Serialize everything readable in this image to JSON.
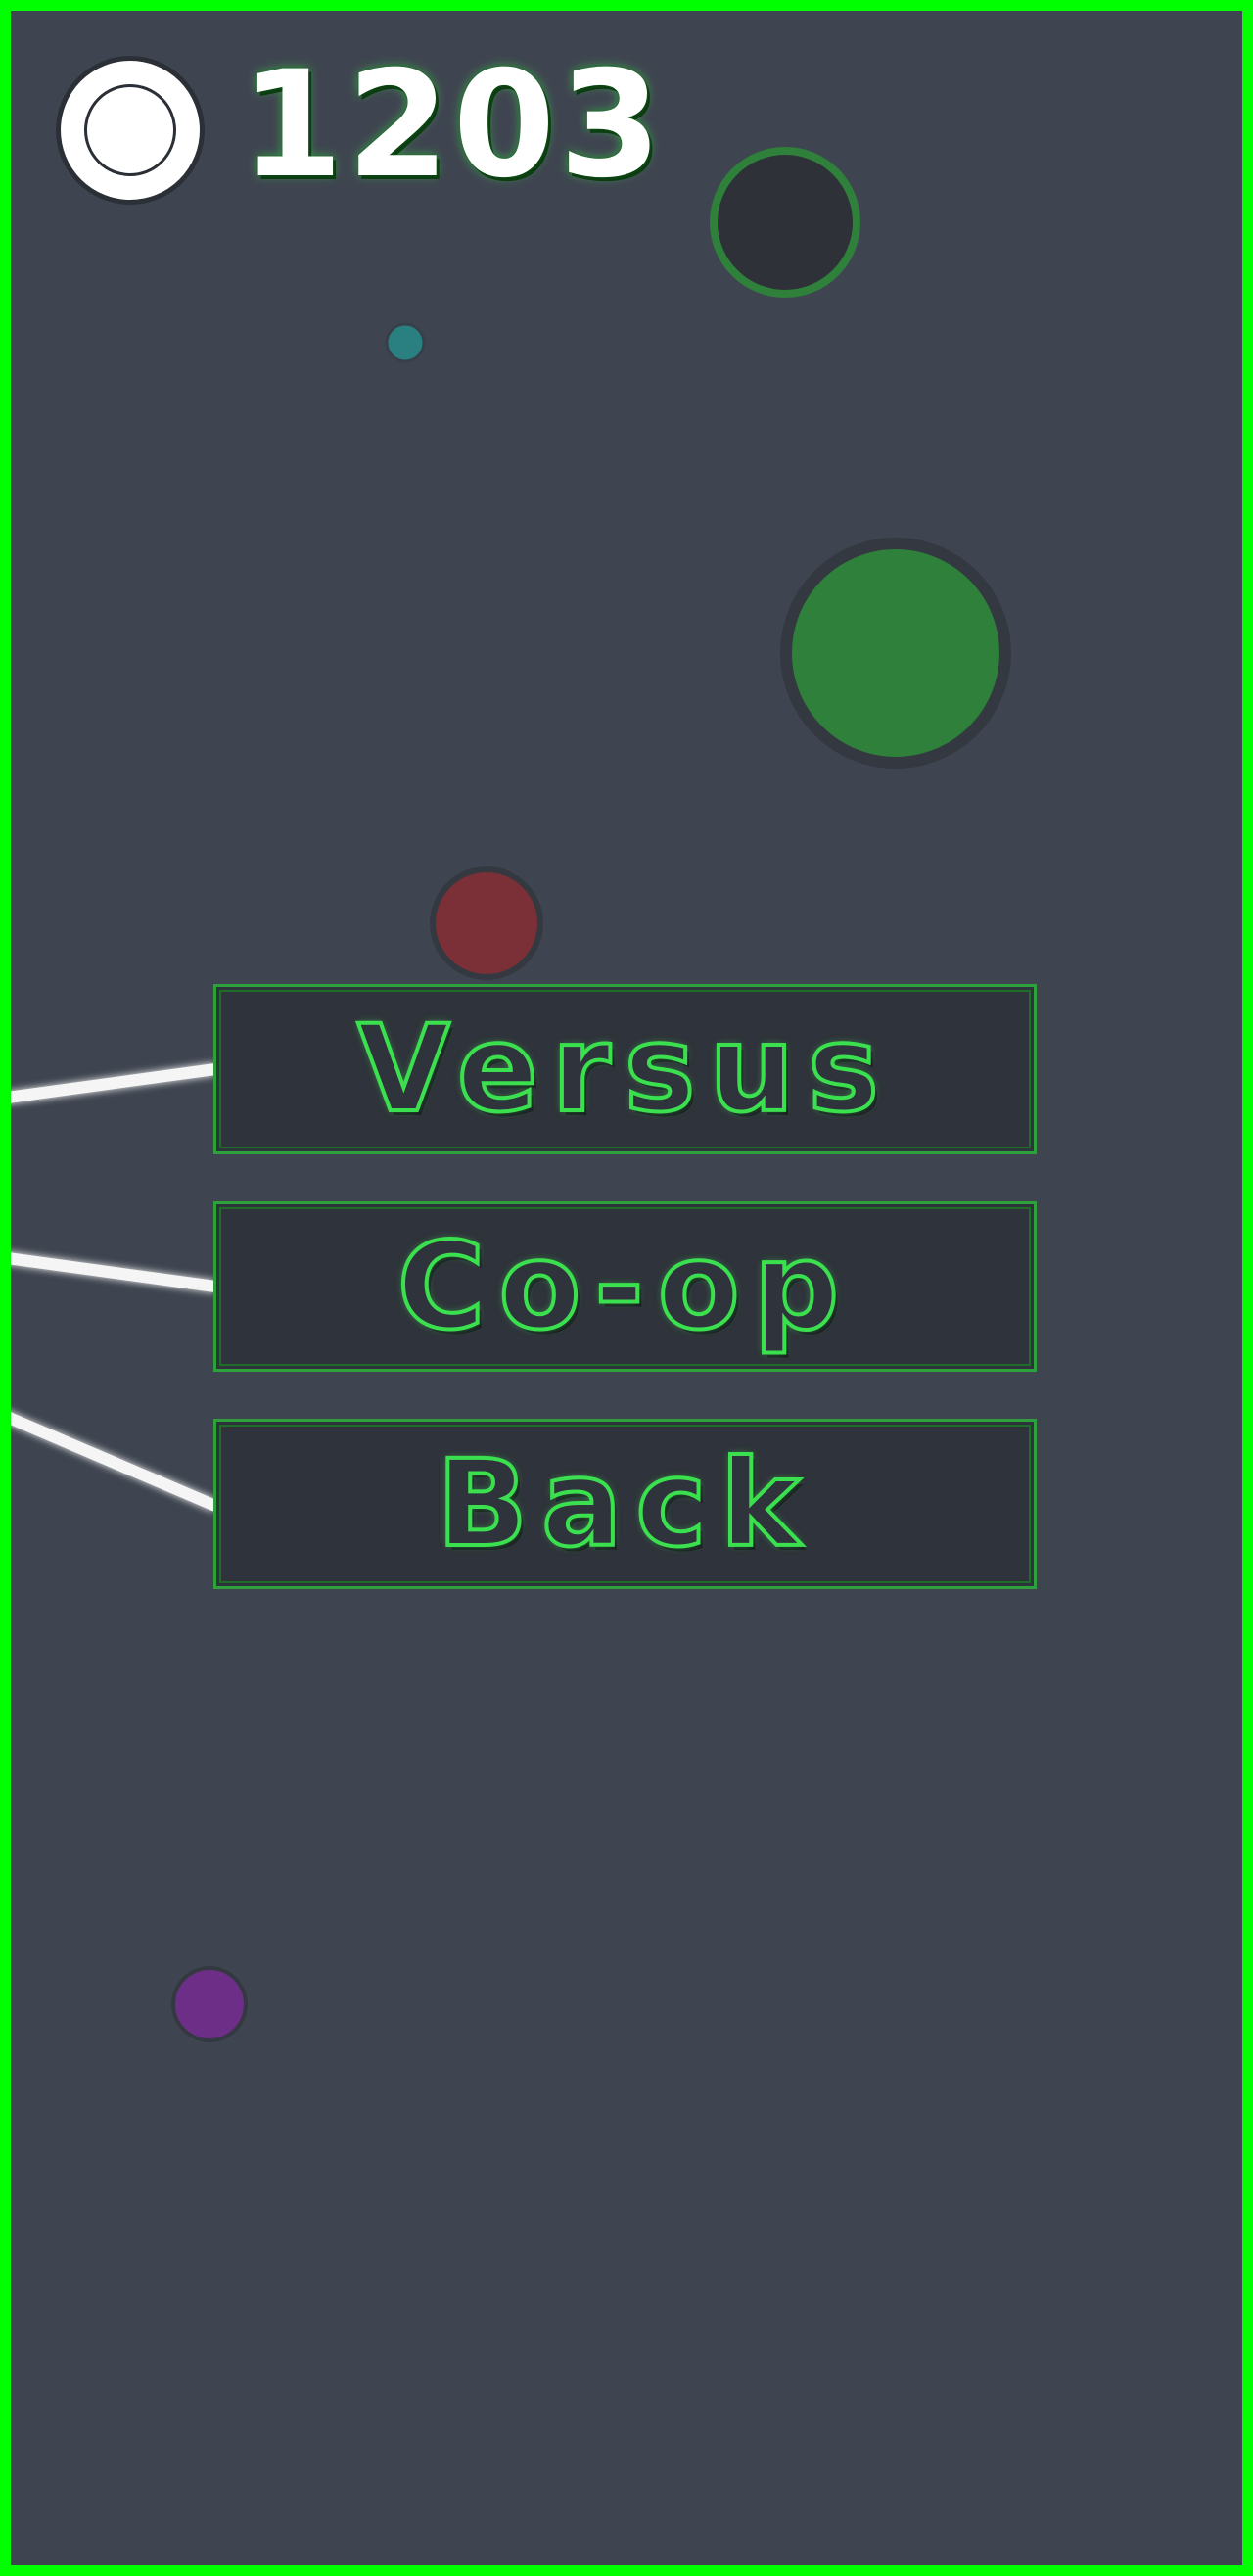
{
  "hud": {
    "coin_icon": "coin-icon",
    "score": "1203"
  },
  "menu": {
    "buttons": [
      {
        "id": "versus",
        "label": "Versus"
      },
      {
        "id": "coop",
        "label": "Co-op"
      },
      {
        "id": "back",
        "label": "Back"
      }
    ]
  },
  "colors": {
    "border": "#00ff00",
    "background": "#3f4550",
    "button_fill": "#2f333b",
    "button_outline": "#2ea03c",
    "text_glow": "#3be04f",
    "orb_dark": "#2e3238",
    "orb_green": "#2e803a",
    "orb_teal": "#2a8080",
    "orb_red": "#7a3036",
    "orb_purple": "#6c2e86",
    "beam": "#ffffff"
  }
}
